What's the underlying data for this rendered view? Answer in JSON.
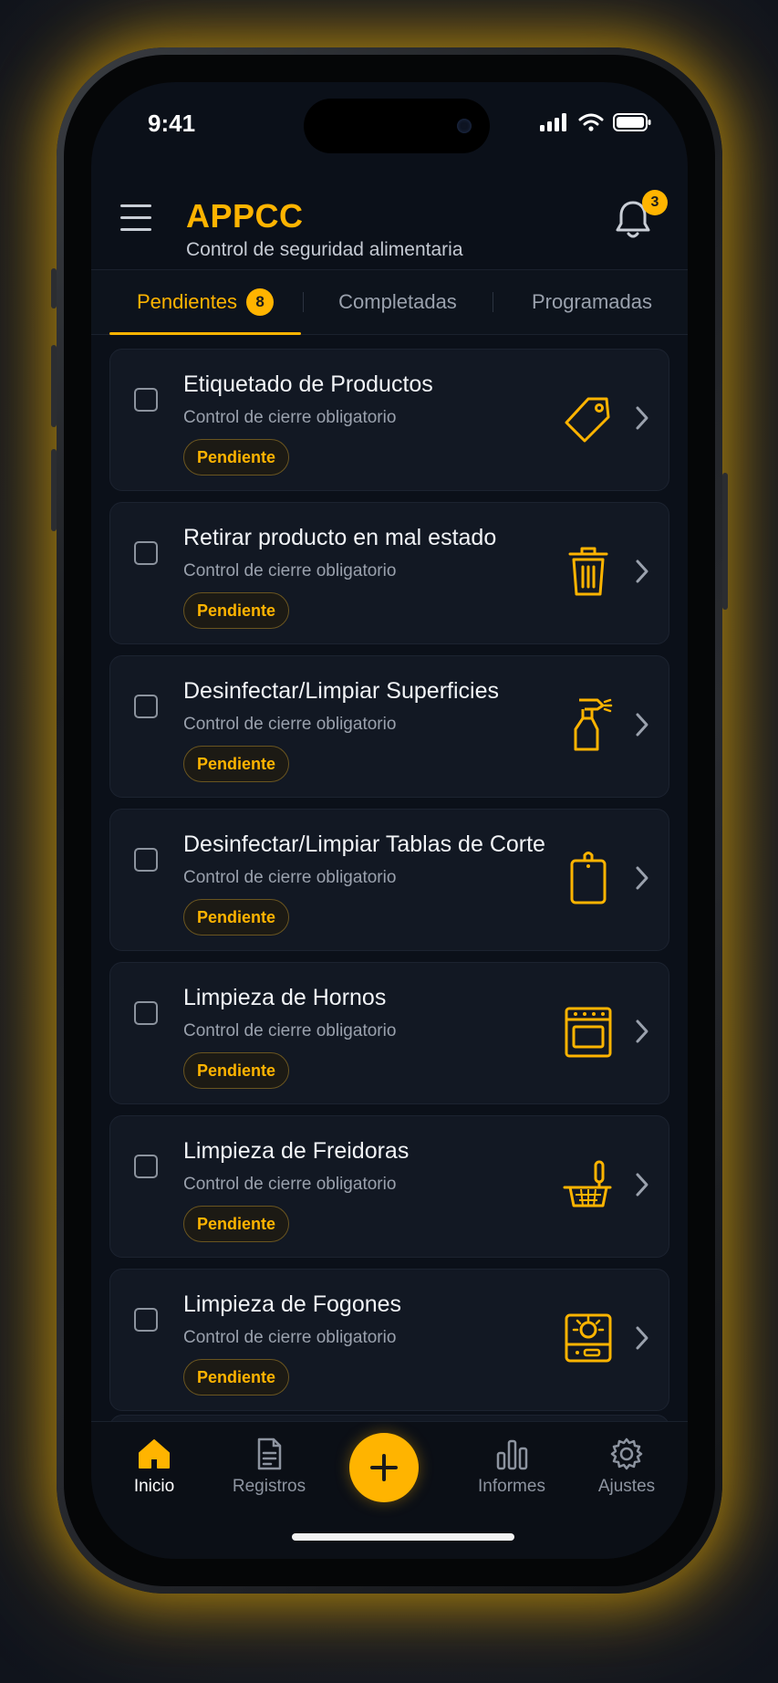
{
  "status_bar": {
    "time": "9:41"
  },
  "header": {
    "title": "APPCC",
    "subtitle": "Control de seguridad alimentaria",
    "notification_count": "3"
  },
  "tabs": [
    {
      "label": "Pendientes",
      "count": "8",
      "active": true
    },
    {
      "label": "Completadas",
      "active": false
    },
    {
      "label": "Programadas",
      "active": false
    }
  ],
  "tasks": [
    {
      "title": "Etiquetado de Productos",
      "subtitle": "Control de cierre obligatorio",
      "status": "Pendiente",
      "icon": "tag-icon"
    },
    {
      "title": "Retirar producto en mal estado",
      "subtitle": "Control de cierre obligatorio",
      "status": "Pendiente",
      "icon": "trash-icon"
    },
    {
      "title": "Desinfectar/Limpiar Superficies",
      "subtitle": "Control de cierre obligatorio",
      "status": "Pendiente",
      "icon": "spray-bottle-icon"
    },
    {
      "title": "Desinfectar/Limpiar Tablas de Corte",
      "subtitle": "Control de cierre obligatorio",
      "status": "Pendiente",
      "icon": "cutting-board-icon"
    },
    {
      "title": "Limpieza de Hornos",
      "subtitle": "Control de cierre obligatorio",
      "status": "Pendiente",
      "icon": "oven-icon"
    },
    {
      "title": "Limpieza de Freidoras",
      "subtitle": "Control de cierre obligatorio",
      "status": "Pendiente",
      "icon": "fryer-icon"
    },
    {
      "title": "Limpieza de Fogones",
      "subtitle": "Control de cierre obligatorio",
      "status": "Pendiente",
      "icon": "stove-icon"
    }
  ],
  "bottom_nav": [
    {
      "label": "Inicio",
      "icon": "home-icon",
      "active": true
    },
    {
      "label": "Registros",
      "icon": "document-icon",
      "active": false
    },
    {
      "label": "Informes",
      "icon": "bar-chart-icon",
      "active": false
    },
    {
      "label": "Ajustes",
      "icon": "gear-icon",
      "active": false
    }
  ],
  "fab": {
    "icon": "plus-icon"
  },
  "colors": {
    "accent": "#ffb400",
    "background": "#0b1019",
    "card": "#121823"
  }
}
